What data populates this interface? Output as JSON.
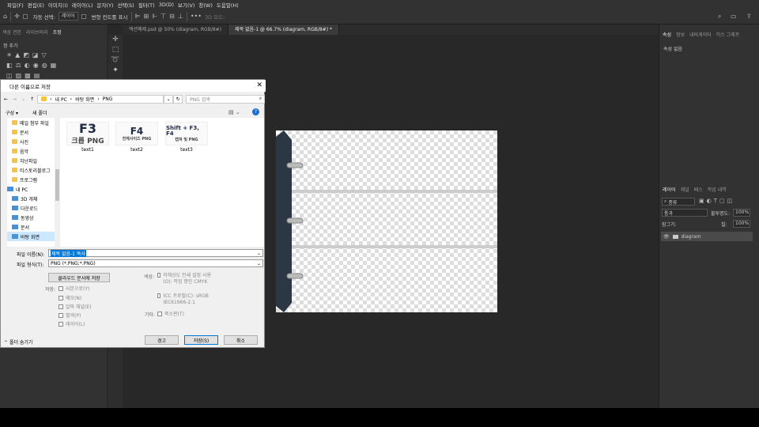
{
  "menu": [
    "파일(F)",
    "편집(E)",
    "이미지(I)",
    "레이어(L)",
    "문자(Y)",
    "선택(S)",
    "필터(T)",
    "3D(D)",
    "보기(V)",
    "창(W)",
    "도움말(H)"
  ],
  "options": {
    "auto_select_label": "자동 선택:",
    "layer_value": "레이어",
    "transform_label": "변형 컨트롤 표시",
    "mode_3d": "3D 모드:"
  },
  "doc_tabs": [
    "액션예제.psd @ 50% (diagram, RGB/8#)",
    "제목 없음-1 @ 66.7% (diagram, RGB/8#) *"
  ],
  "left_panel": {
    "tabs": [
      "색상 견본",
      "라이브러리",
      "조정"
    ],
    "add_label": "정 추가"
  },
  "right_panel": {
    "top_tabs": [
      "속성",
      "정보",
      "내비게이터",
      "히스 그래프"
    ],
    "props_empty": "속성 없음",
    "layer_tabs": [
      "레이어",
      "채널",
      "패스",
      "작업 내역"
    ],
    "filter_label": "종류",
    "blend_mode": "통과",
    "opacity_label": "불투명도:",
    "opacity_value": "100%",
    "lock_label": "잠그기:",
    "fill_label": "칠:",
    "fill_value": "100%",
    "layer_name": "diagram"
  },
  "dialog": {
    "title": "다른 이름으로 저장",
    "breadcrumb": [
      "내 PC",
      "바탕 화면",
      "PNG"
    ],
    "search_placeholder": "PNG 검색",
    "organize": "구성 ▾",
    "new_folder": "새 폴더",
    "tree": [
      {
        "label": "메일 첨부 파일",
        "type": "folder"
      },
      {
        "label": "문서",
        "type": "folder"
      },
      {
        "label": "사진",
        "type": "folder"
      },
      {
        "label": "음악",
        "type": "folder"
      },
      {
        "label": "치난파일",
        "type": "folder"
      },
      {
        "label": "티스토리블로그",
        "type": "folder"
      },
      {
        "label": "프로그램",
        "type": "folder"
      },
      {
        "label": "내 PC",
        "type": "pc"
      },
      {
        "label": "3D 개체",
        "type": "pc"
      },
      {
        "label": "다운로드",
        "type": "pc"
      },
      {
        "label": "동영상",
        "type": "pc"
      },
      {
        "label": "문서",
        "type": "pc"
      },
      {
        "label": "바탕 화면",
        "type": "pc"
      }
    ],
    "files": [
      {
        "name": "text1",
        "big": "F3",
        "sub": "크롭 PNG"
      },
      {
        "name": "text2",
        "big": "F4",
        "sub": "전체사이즈 PNG"
      },
      {
        "name": "text3",
        "big": "Shift + F3, F4",
        "sub": "캡쳐 및 PNG"
      }
    ],
    "filename_label": "파일 이름(N):",
    "filename_value": "제목 없음-1 복사",
    "format_label": "파일 형식(T):",
    "format_value": "PNG (*.PNG;*.PNG)",
    "cloud_button": "클라우드 문서에 저장",
    "save_label": "저장:",
    "as_copy": "사본으로(Y)",
    "notes": "메모(N)",
    "alpha": "알파 채널(E)",
    "spot": "별색(P)",
    "layers": "레이어(L)",
    "color_label": "색상:",
    "proof_setup": "저해상도 인쇄 설정 사용(O): 작업 중인 CMYK",
    "icc": "ICC 프로필(C): sRGB IEC61966-2.1",
    "other_label": "기타:",
    "thumbnail": "축소판(T)",
    "hide_folders": "폴더 숨기기",
    "warning_button": "경고",
    "save_button": "저장(S)",
    "cancel_button": "취소"
  }
}
